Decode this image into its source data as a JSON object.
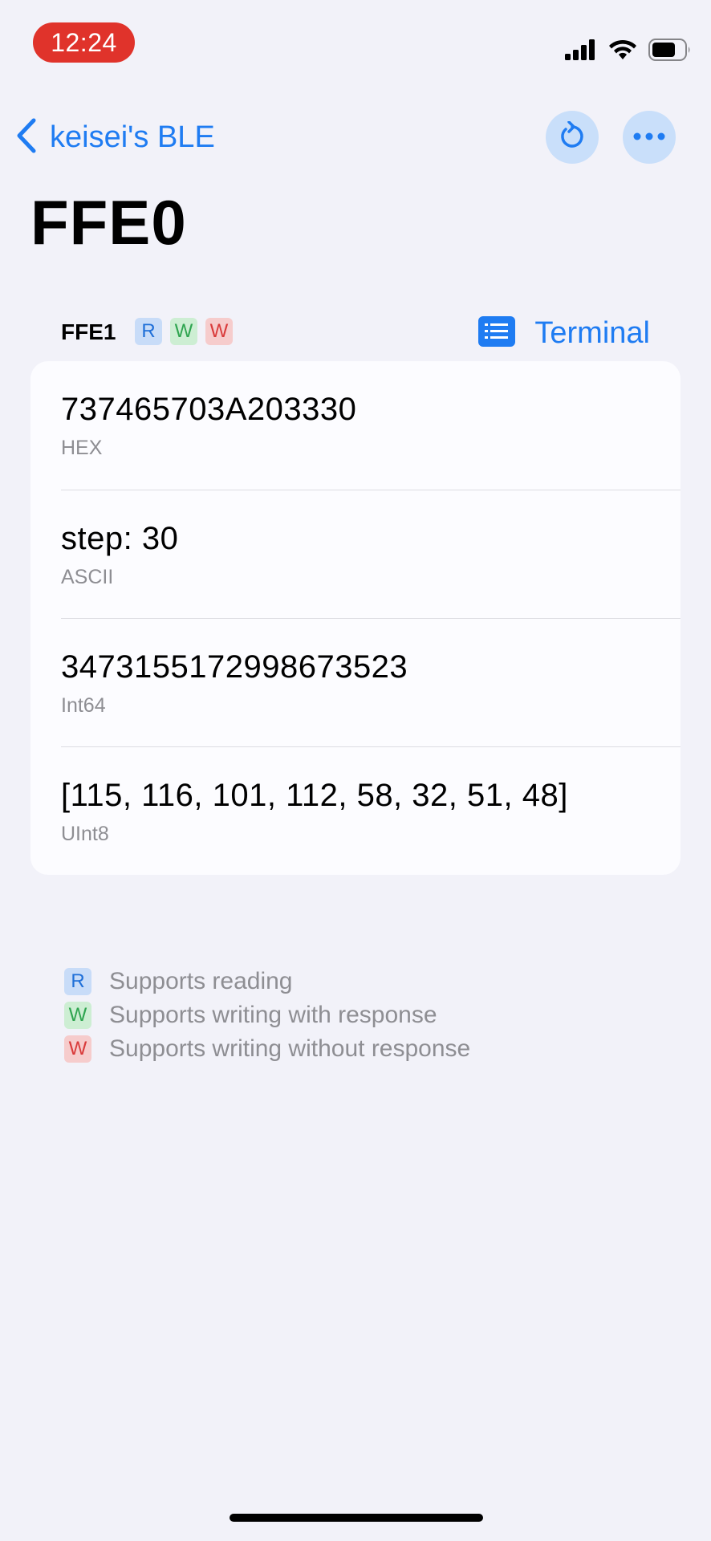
{
  "status_bar": {
    "time": "12:24"
  },
  "nav": {
    "back_label": "keisei's BLE",
    "accent_color": "#1f7cf2"
  },
  "page": {
    "title": "FFE0"
  },
  "characteristic": {
    "name": "FFE1",
    "badges": [
      "R",
      "W",
      "W"
    ],
    "terminal_label": "Terminal"
  },
  "values": [
    {
      "value": "737465703A203330",
      "label": "HEX"
    },
    {
      "value": "step: 30",
      "label": "ASCII"
    },
    {
      "value": "3473155172998673523",
      "label": "Int64"
    },
    {
      "value": "[115, 116, 101, 112, 58, 32, 51, 48]",
      "label": "UInt8"
    }
  ],
  "legend": [
    {
      "badge": "R",
      "text": "Supports reading",
      "color": "#1f6fd8"
    },
    {
      "badge": "W",
      "text": "Supports writing with response",
      "color": "#2ea44f"
    },
    {
      "badge": "W",
      "text": "Supports writing without response",
      "color": "#d93a3a"
    }
  ]
}
